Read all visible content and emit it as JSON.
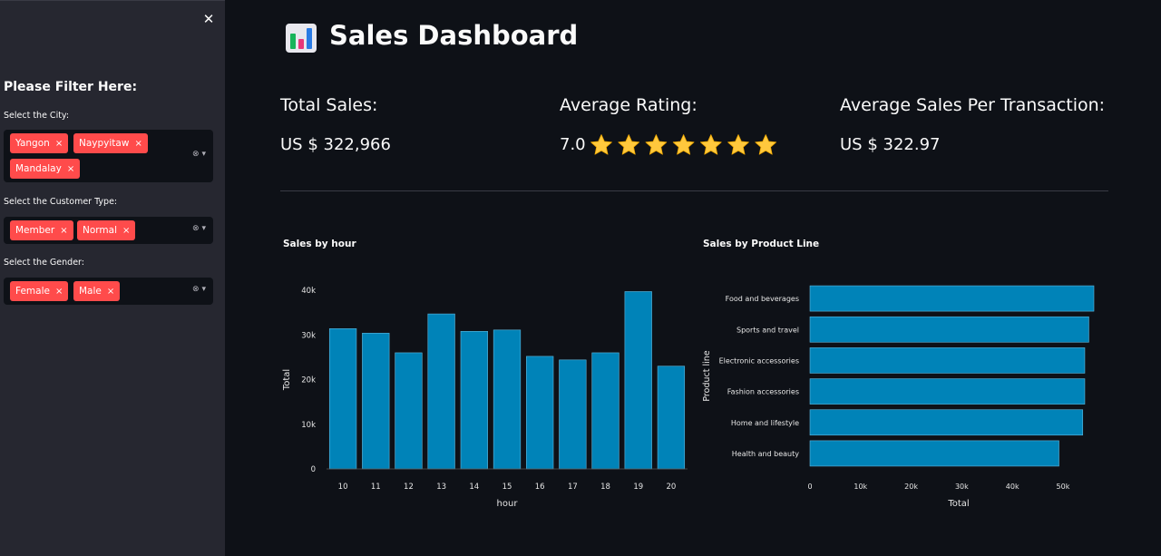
{
  "sidebar": {
    "heading": "Please Filter Here:",
    "city": {
      "label": "Select the City:",
      "tags": [
        "Yangon",
        "Naypyitaw",
        "Mandalay"
      ]
    },
    "customer_type": {
      "label": "Select the Customer Type:",
      "tags": [
        "Member",
        "Normal"
      ]
    },
    "gender": {
      "label": "Select the Gender:",
      "tags": [
        "Female",
        "Male"
      ]
    },
    "tag_remove": "×",
    "clear_icon": "⊗",
    "dropdown_icon": "▾",
    "close": "✕"
  },
  "header": {
    "title": "Sales Dashboard",
    "icon": "bar-chart-icon"
  },
  "kpis": {
    "total_sales_label": "Total Sales:",
    "total_sales_value": "US $ 322,966",
    "avg_rating_label": "Average Rating:",
    "avg_rating_value": "7.0",
    "avg_rating_stars": 7,
    "avg_per_tx_label": "Average Sales Per Transaction:",
    "avg_per_tx_value": "US $ 322.97"
  },
  "colors": {
    "bar": "#0083b8",
    "accent_tag": "#ff4b4b",
    "star": "#ffc83d",
    "bg": "#0e1117",
    "sidebar": "#262730"
  },
  "chart_data": [
    {
      "type": "bar",
      "title": "Sales by hour",
      "xlabel": "hour",
      "ylabel": "Total",
      "categories": [
        "10",
        "11",
        "12",
        "13",
        "14",
        "15",
        "16",
        "17",
        "18",
        "19",
        "20"
      ],
      "values": [
        31400,
        30400,
        26000,
        34700,
        30800,
        31100,
        25200,
        24400,
        26000,
        39700,
        23000
      ],
      "ylim": [
        0,
        40000
      ],
      "yticks": [
        "0",
        "10k",
        "20k",
        "30k",
        "40k"
      ],
      "grid": false
    },
    {
      "type": "bar",
      "orientation": "horizontal",
      "title": "Sales by Product Line",
      "xlabel": "Total",
      "ylabel": "Product line",
      "categories": [
        "Food and beverages",
        "Sports and travel",
        "Electronic accessories",
        "Fashion accessories",
        "Home and lifestyle",
        "Health and beauty"
      ],
      "values": [
        56100,
        55100,
        54300,
        54300,
        53900,
        49200
      ],
      "xlim": [
        0,
        56100
      ],
      "xticks": [
        "0",
        "10k",
        "20k",
        "30k",
        "40k",
        "50k"
      ],
      "grid": false
    }
  ]
}
